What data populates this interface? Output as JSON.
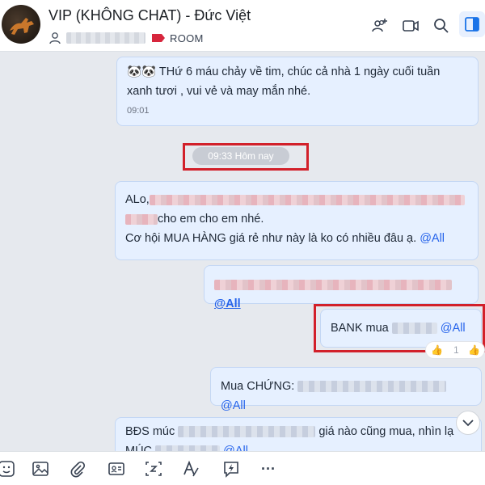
{
  "header": {
    "title": "VIP (KHÔNG CHAT) - Đức Việt",
    "room_label": "ROOM"
  },
  "chat": {
    "messages": [
      {
        "emoji": "🐼🐼",
        "text_line1": "THứ 6 máu chảy về tim, chúc cả nhà 1 ngày cuối tuần",
        "text_line2": "xanh tươi , vui vẻ và may mắn nhé.",
        "time": "09:01"
      },
      {
        "prefix": "ALo,",
        "line2_text": "cho em cho em nhé.",
        "line3_text": "Cơ hội MUA HÀNG giá rẻ như này là ko có nhiều đâu ạ.",
        "mention": "@All"
      },
      {
        "mention": "@All"
      },
      {
        "prefix": "BANK mua",
        "mention": "@All"
      },
      {
        "prefix": "Mua CHỨNG:",
        "mention": "@All"
      },
      {
        "prefix": "BĐS múc",
        "middle": "giá nào cũng mua, nhìn lạ",
        "line2_prefix": "MÚC",
        "line2_mention": "@All"
      }
    ],
    "date_separator": "09:33 Hôm nay"
  },
  "toolbar": {
    "icons": [
      "sticker-icon",
      "image-icon",
      "attachment-icon",
      "contact-card-icon",
      "screenshot-icon",
      "text-format-icon",
      "quick-message-icon",
      "more-icon"
    ],
    "more_label": "···"
  }
}
